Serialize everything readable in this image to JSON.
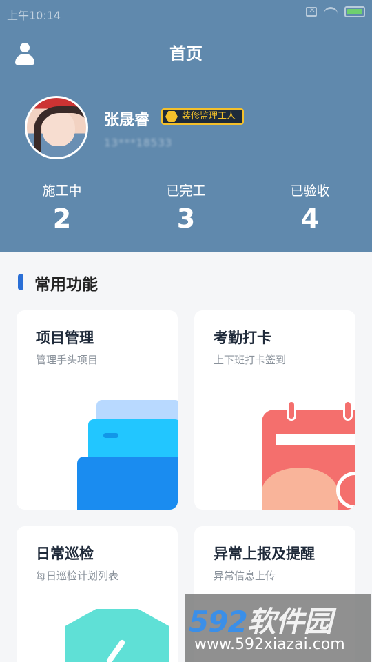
{
  "status_bar": {
    "time": "上午10:14"
  },
  "header": {
    "title": "首页"
  },
  "profile": {
    "name": "张晟睿",
    "role_badge": "装修监理工人",
    "phone_masked": "13***18533"
  },
  "stats": [
    {
      "label": "施工中",
      "value": "2"
    },
    {
      "label": "已完工",
      "value": "3"
    },
    {
      "label": "已验收",
      "value": "4"
    }
  ],
  "section": {
    "title": "常用功能"
  },
  "cards": [
    {
      "title": "项目管理",
      "subtitle": "管理手头项目",
      "icon": "folder-icon"
    },
    {
      "title": "考勤打卡",
      "subtitle": "上下班打卡签到",
      "icon": "calendar-icon"
    },
    {
      "title": "日常巡检",
      "subtitle": "每日巡检计划列表",
      "icon": "shield-check-icon"
    },
    {
      "title": "异常上报及提醒",
      "subtitle": "异常信息上传",
      "icon": "alert-icon"
    }
  ],
  "watermark": {
    "logo_number": "592",
    "logo_text": "软件园",
    "url": "www.592xiazai.com"
  },
  "colors": {
    "header_bg": "#6089ad",
    "accent": "#2a6fd6",
    "badge": "#f3c02b"
  }
}
